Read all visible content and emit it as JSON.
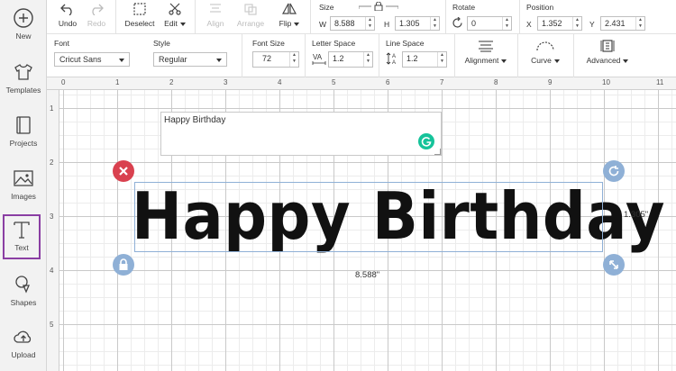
{
  "sidebar": {
    "items": [
      {
        "label": "New",
        "icon": "plus-circle-icon"
      },
      {
        "label": "Templates",
        "icon": "shirt-icon"
      },
      {
        "label": "Projects",
        "icon": "projects-icon"
      },
      {
        "label": "Images",
        "icon": "image-icon"
      },
      {
        "label": "Text",
        "icon": "text-icon",
        "active": true
      },
      {
        "label": "Shapes",
        "icon": "shapes-icon"
      },
      {
        "label": "Upload",
        "icon": "upload-cloud-icon"
      }
    ]
  },
  "toolbar": {
    "undo": "Undo",
    "redo": "Redo",
    "deselect": "Deselect",
    "edit": "Edit",
    "align": "Align",
    "arrange": "Arrange",
    "flip": "Flip",
    "size": {
      "label": "Size",
      "w_label": "W",
      "w_value": "8.588",
      "h_label": "H",
      "h_value": "1.305"
    },
    "rotate": {
      "label": "Rotate",
      "value": "0"
    },
    "position": {
      "label": "Position",
      "x_label": "X",
      "x_value": "1.352",
      "y_label": "Y",
      "y_value": "2.431"
    }
  },
  "text_toolbar": {
    "font_label": "Font",
    "font_value": "Cricut Sans",
    "style_label": "Style",
    "style_value": "Regular",
    "font_size_label": "Font Size",
    "font_size_value": "72",
    "letter_space_label": "Letter Space",
    "letter_space_value": "1.2",
    "line_space_label": "Line Space",
    "line_space_value": "1.2",
    "alignment": "Alignment",
    "curve": "Curve",
    "advanced": "Advanced"
  },
  "ruler": {
    "top": [
      "0",
      "1",
      "2",
      "3",
      "4",
      "5",
      "6",
      "7",
      "8",
      "9",
      "10",
      "11"
    ],
    "left": [
      "1",
      "2",
      "3",
      "4",
      "5"
    ]
  },
  "canvas": {
    "edit_text": "Happy Birthday",
    "display_text": "Happy Birthday",
    "width_readout": "8.588\"",
    "height_readout": "1.305\""
  },
  "colors": {
    "accent": "#8a3ea3",
    "delete": "#d9414f",
    "handle": "#8fb0d6",
    "grammarly": "#15c39a"
  }
}
